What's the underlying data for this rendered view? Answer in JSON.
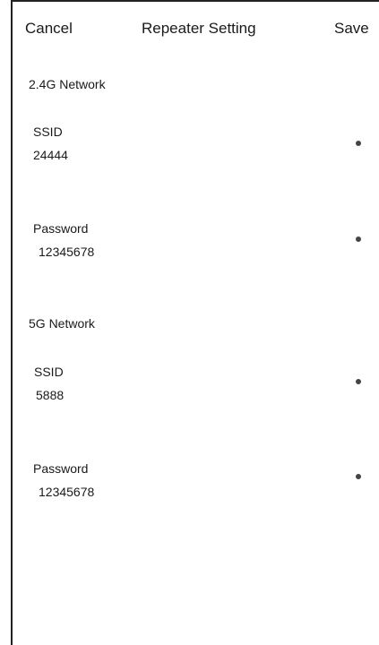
{
  "header": {
    "cancel_label": "Cancel",
    "title": "Repeater Setting",
    "save_label": "Save"
  },
  "network_24g": {
    "section_title": "2.4G Network",
    "ssid_label": "SSID",
    "ssid_value": "24444",
    "password_label": "Password",
    "password_value": "12345678"
  },
  "network_5g": {
    "section_title": "5G Network",
    "ssid_label": "SSID",
    "ssid_value": "5888",
    "password_label": "Password",
    "password_value": "12345678"
  }
}
